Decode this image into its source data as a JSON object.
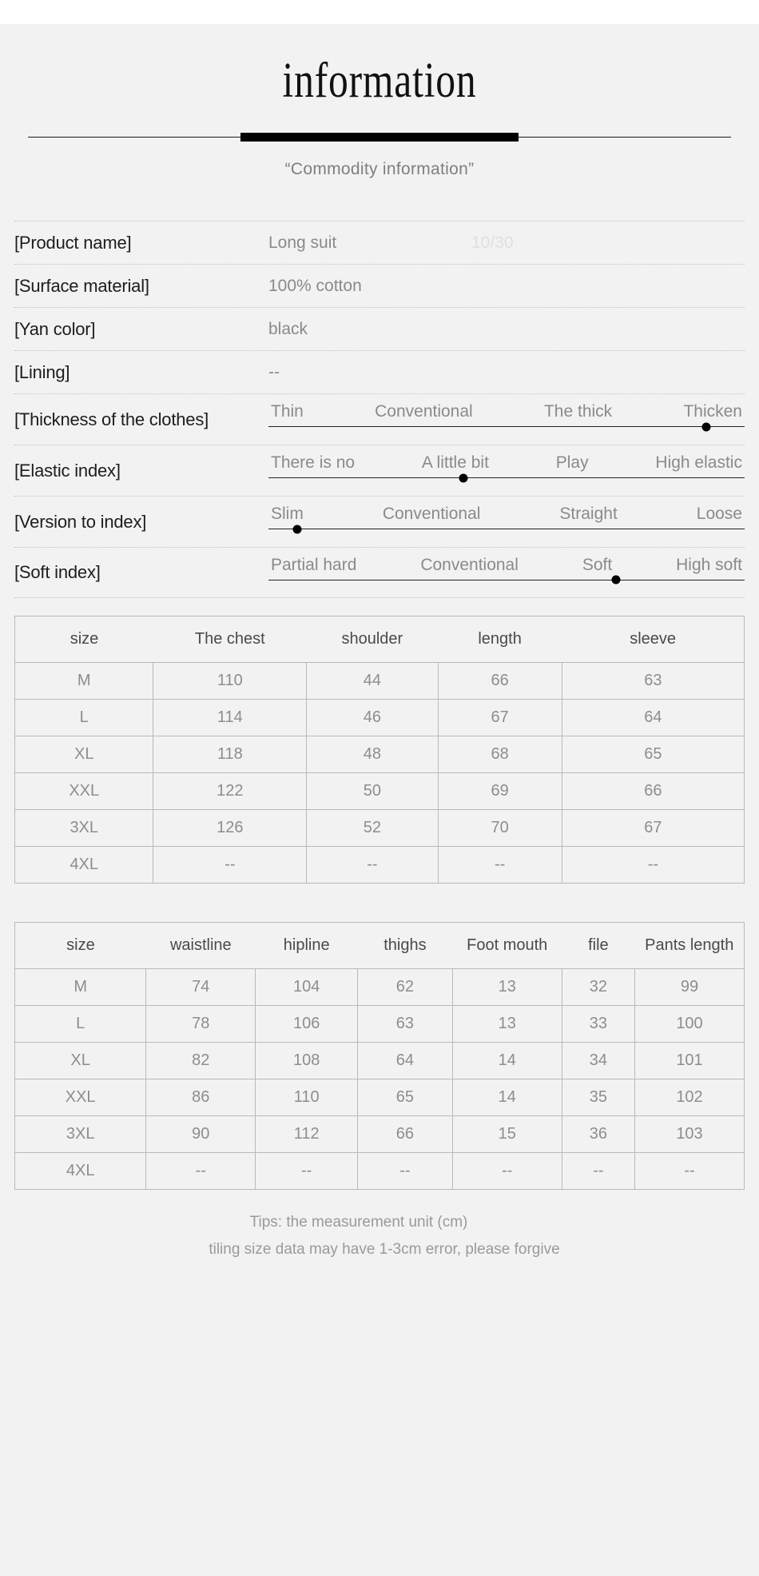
{
  "header": {
    "title": "information",
    "subtitle": "“Commodity information”"
  },
  "specs": [
    {
      "label": "[Product name]",
      "value": "Long suit",
      "muted": "10/30"
    },
    {
      "label": "[Surface material]",
      "value": "100% cotton"
    },
    {
      "label": "[Yan color]",
      "value": "black"
    },
    {
      "label": "[Lining]",
      "value": "--"
    }
  ],
  "scales": [
    {
      "label": "[Thickness of the clothes]",
      "options": [
        "Thin",
        "Conventional",
        "The thick",
        "Thicken"
      ],
      "selected_index": 3,
      "dot_percent": 92
    },
    {
      "label": "[Elastic index]",
      "options": [
        "There is no",
        "A little bit",
        "Play",
        "High elastic"
      ],
      "selected_index": 1,
      "dot_percent": 41
    },
    {
      "label": "[Version to index]",
      "options": [
        "Slim",
        "Conventional",
        "Straight",
        "Loose"
      ],
      "selected_index": 0,
      "dot_percent": 6
    },
    {
      "label": "[Soft index]",
      "options": [
        "Partial hard",
        "Conventional",
        "Soft",
        "High soft"
      ],
      "selected_index": 2,
      "dot_percent": 73
    }
  ],
  "table_top": {
    "columns": [
      "size",
      "The chest",
      "shoulder",
      "length",
      "sleeve"
    ],
    "col_widths": [
      "19%",
      "21%",
      "18%",
      "17%",
      "25%"
    ],
    "rows": [
      [
        "M",
        "110",
        "44",
        "66",
        "63"
      ],
      [
        "L",
        "114",
        "46",
        "67",
        "64"
      ],
      [
        "XL",
        "118",
        "48",
        "68",
        "65"
      ],
      [
        "XXL",
        "122",
        "50",
        "69",
        "66"
      ],
      [
        "3XL",
        "126",
        "52",
        "70",
        "67"
      ],
      [
        "4XL",
        "--",
        "--",
        "--",
        "--"
      ]
    ]
  },
  "table_bottom": {
    "columns": [
      "size",
      "waistline",
      "hipline",
      "thighs",
      "Foot mouth",
      "file",
      "Pants length"
    ],
    "col_widths": [
      "18%",
      "15%",
      "14%",
      "13%",
      "15%",
      "10%",
      "15%"
    ],
    "rows": [
      [
        "M",
        "74",
        "104",
        "62",
        "13",
        "32",
        "99"
      ],
      [
        "L",
        "78",
        "106",
        "63",
        "13",
        "33",
        "100"
      ],
      [
        "XL",
        "82",
        "108",
        "64",
        "14",
        "34",
        "101"
      ],
      [
        "XXL",
        "86",
        "110",
        "65",
        "14",
        "35",
        "102"
      ],
      [
        "3XL",
        "90",
        "112",
        "66",
        "15",
        "36",
        "103"
      ],
      [
        "4XL",
        "--",
        "--",
        "--",
        "--",
        "--",
        "--"
      ]
    ]
  },
  "tips": {
    "line1": "Tips: the measurement unit (cm)",
    "line2": "tiling size data may have 1-3cm error, please forgive"
  },
  "colors": {
    "background": "#f2f2f2",
    "label_text": "#1d1d1d",
    "value_text": "#8a8a8a",
    "muted_text": "#e0e0e0",
    "rule": "#000000",
    "table_border": "#b9b9b9"
  }
}
